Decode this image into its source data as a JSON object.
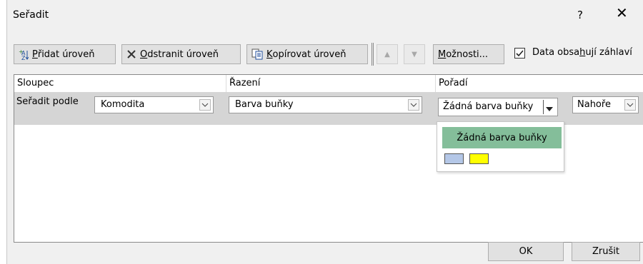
{
  "dialog": {
    "title": "Seřadit",
    "help_label": "?",
    "close_label": "✕"
  },
  "toolbar": {
    "add_level": {
      "accel": "P",
      "rest": "řidat úroveň"
    },
    "delete_level": {
      "accel": "O",
      "rest": "dstranit úroveň"
    },
    "copy_level": {
      "accel": "K",
      "rest": "opírovat úroveň"
    },
    "move_up_label": "▲",
    "move_down_label": "▼",
    "options": {
      "accel": "M",
      "rest": "ožnosti..."
    },
    "headers_checkbox": {
      "checked": true,
      "check_mark": "✓",
      "pre": "Data obsa",
      "accel": "h",
      "post": "ují záhlaví"
    }
  },
  "grid": {
    "headers": {
      "column": "Sloupec",
      "sort_on": "Řazení",
      "order": "Pořadí"
    },
    "rows": [
      {
        "label": "Seřadit podle",
        "column": "Komodita",
        "sort_on": "Barva buňky",
        "order": "Žádná barva buňky",
        "position": "Nahoře"
      }
    ]
  },
  "dropdown": {
    "selected": "Žádná barva buňky",
    "swatches": [
      "#b4c7e7",
      "#ffff00"
    ]
  },
  "footer": {
    "ok_label": "OK",
    "cancel_label": "Zrušit"
  },
  "colors": {
    "highlight": "#84be9a",
    "row_bg": "#d5d5d5"
  }
}
